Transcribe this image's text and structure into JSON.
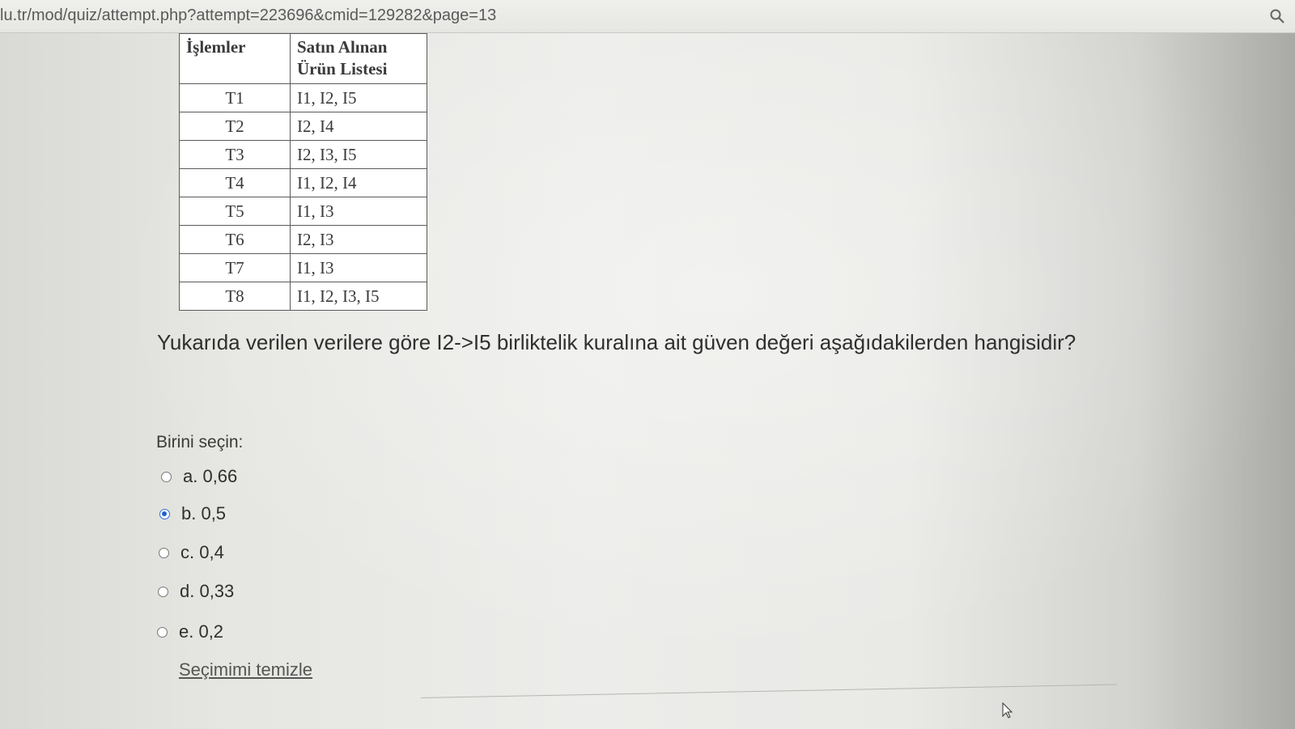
{
  "browser": {
    "url": "lu.tr/mod/quiz/attempt.php?attempt=223696&cmid=129282&page=13"
  },
  "table": {
    "headers": [
      "İşlemler",
      "Satın Alınan\nÜrün Listesi"
    ],
    "rows": [
      [
        "T1",
        "I1, I2, I5"
      ],
      [
        "T2",
        "I2, I4"
      ],
      [
        "T3",
        "I2, I3, I5"
      ],
      [
        "T4",
        "I1, I2, I4"
      ],
      [
        "T5",
        "I1, I3"
      ],
      [
        "T6",
        "I2, I3"
      ],
      [
        "T7",
        "I1, I3"
      ],
      [
        "T8",
        "I1, I2, I3, I5"
      ]
    ]
  },
  "question": {
    "text": "Yukarıda verilen verilere göre I2->I5 birliktelik kuralına ait güven değeri aşağıdakilerden hangisidir?",
    "prompt": "Birini seçin:",
    "options": [
      {
        "label": "a. 0,66",
        "selected": false
      },
      {
        "label": "b. 0,5",
        "selected": true
      },
      {
        "label": "c. 0,4",
        "selected": false
      },
      {
        "label": "d. 0,33",
        "selected": false
      },
      {
        "label": "e. 0,2",
        "selected": false
      }
    ],
    "clear_label": "Seçimimi temizle"
  },
  "colors": {
    "radio_selected": "#1f5fcf"
  },
  "icons": [
    "zoom-icon",
    "mouse-cursor-icon"
  ]
}
